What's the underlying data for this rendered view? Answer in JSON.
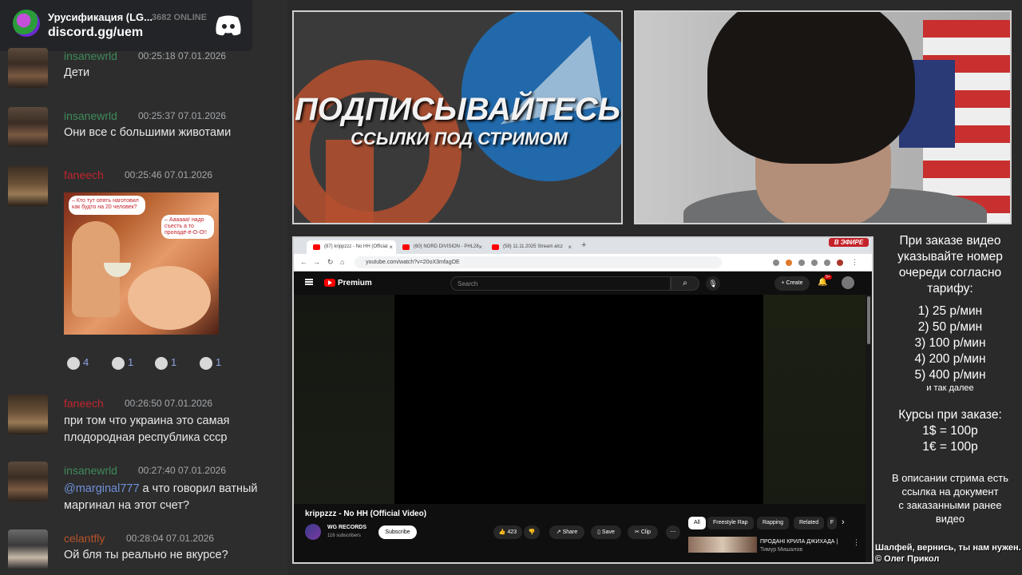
{
  "discord": {
    "server_name": "Урусификация (LG...",
    "online": "3682 ONLINE",
    "invite": "discord.gg/uem",
    "messages": [
      {
        "user": "insanewrld",
        "time": "00:25:18 07.01.2026",
        "text": "Дети"
      },
      {
        "user": "insanewrld",
        "time": "00:25:37 07.01.2026",
        "text": "Они все с большими животами"
      },
      {
        "user": "faneech",
        "time": "00:25:46 07.01.2026",
        "text": ""
      },
      {
        "user": "faneech",
        "time": "00:26:50 07.01.2026",
        "text": "при том что украина это самая плодородная республика ссср"
      },
      {
        "user": "insanewrld",
        "time": "00:27:40 07.01.2026",
        "mention": "@marginal777",
        "text": " а что говорил ватный маргинал на этот счет?"
      },
      {
        "user": "celantfly",
        "time": "00:28:04 07.01.2026",
        "text": "Ой бля ты реально не вкурсе?"
      }
    ],
    "meme": {
      "bubble1": "– Кто тут опять наготовил как будто на 20 человек?",
      "bubble2": "– Аааааа! надо съесть а то пропадё-ё-О-О!!"
    },
    "reactions": [
      {
        "icon": "face-emoji-icon",
        "count": "4"
      },
      {
        "icon": "face-emoji-icon",
        "count": "1"
      },
      {
        "icon": "face-emoji-icon",
        "count": "1"
      },
      {
        "icon": "face-emoji-icon",
        "count": "1"
      }
    ]
  },
  "promo": {
    "headline": "ПОДПИСЫВАЙТЕСЬ",
    "subheadline": "ССЫЛКИ ПОД СТРИМОМ"
  },
  "browser": {
    "tabs": [
      {
        "label": "(87) krippzzz - No HH (Official",
        "active": true
      },
      {
        "label": "(60) NORD DIVISION - PHL28",
        "active": false
      },
      {
        "label": "(58) 11.11.2025 Stream alcz",
        "active": false
      }
    ],
    "live_badge": "В ЭФИРЕ",
    "url": "youtube.com/watch?v=20oX3mfagOE"
  },
  "youtube": {
    "brand": "Premium",
    "search_placeholder": "Search",
    "create": "Create",
    "notif_count": "9+",
    "video_title": "krippzzz - No HH (Official Video)",
    "channel": "WG RECORDS",
    "subscribers": "116 subscribers",
    "subscribe": "Subscribe",
    "likes": "423",
    "share": "Share",
    "save": "Save",
    "clip": "Clip",
    "chips": [
      "All",
      "Freestyle Rap",
      "Rapping",
      "Related",
      "F"
    ],
    "rec_title": "ПРОДАНІ КРИЛА ДЖИХАДА |",
    "rec_sub": "Тимур Мишалов"
  },
  "info": {
    "header": [
      "При заказе видео",
      "указывайте номер",
      "очереди согласно",
      "тарифу:"
    ],
    "tiers": [
      "1) 25 р/мин",
      "2) 50 р/мин",
      "3) 100 р/мин",
      "4) 200 р/мин",
      "5) 400 р/мин"
    ],
    "etc": "и так далее",
    "courses_title": "Курсы при заказе:",
    "courses": [
      "1$ = 100р",
      "1€ = 100р"
    ],
    "desc": [
      "В описании стрима есть",
      "ссылка на документ",
      "с заказанными ранее",
      "видео"
    ],
    "credit1": "Шалфей, вернись, ты нам нужен.",
    "credit2": "© Олег Прикол"
  },
  "colors": {
    "discord_bg": "#2d2d2d",
    "username_green": "#3e8a5a",
    "username_red": "#c0262d",
    "mention": "#6f8fd9",
    "yt_red": "#ff0000",
    "live_red": "#c4222a"
  }
}
